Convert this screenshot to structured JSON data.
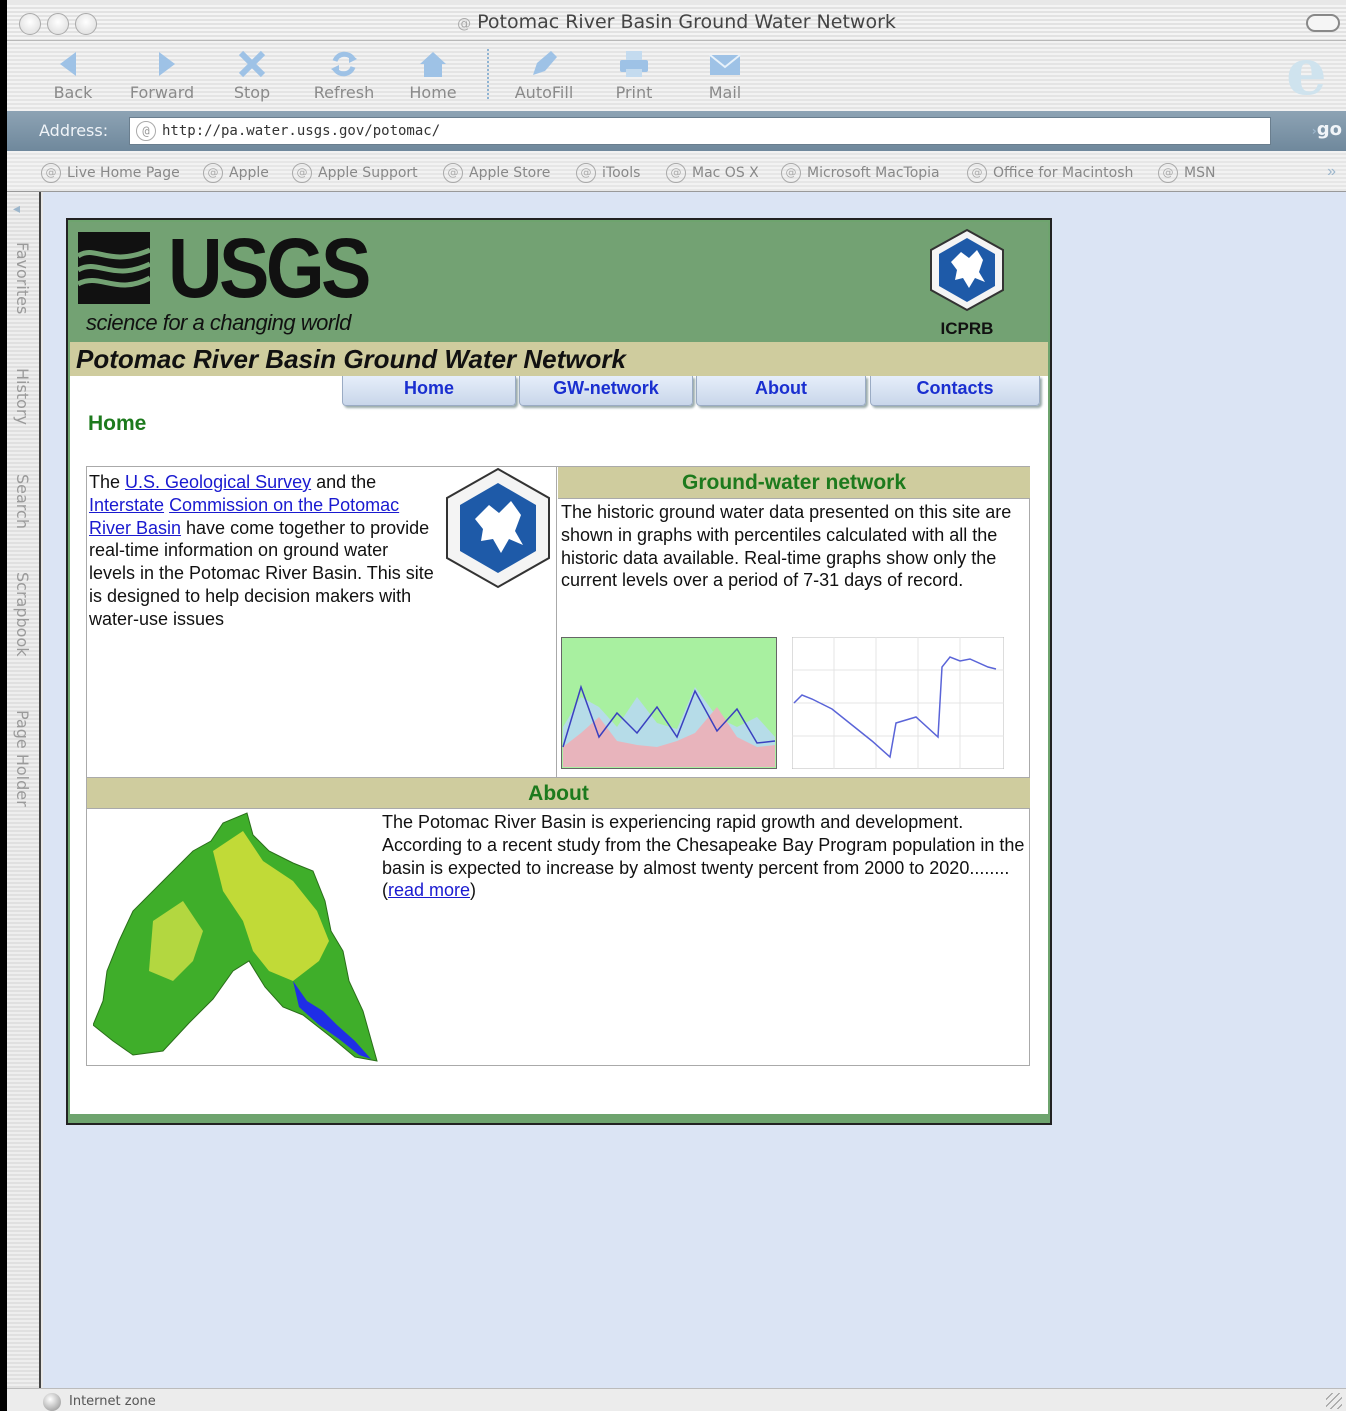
{
  "window": {
    "title": "Potomac River Basin Ground Water Network"
  },
  "toolbar": {
    "buttons": [
      {
        "label": "Back",
        "icon": "back-arrow-icon"
      },
      {
        "label": "Forward",
        "icon": "forward-arrow-icon"
      },
      {
        "label": "Stop",
        "icon": "stop-x-icon"
      },
      {
        "label": "Refresh",
        "icon": "refresh-icon"
      },
      {
        "label": "Home",
        "icon": "home-icon"
      },
      {
        "label": "AutoFill",
        "icon": "autofill-icon"
      },
      {
        "label": "Print",
        "icon": "printer-icon"
      },
      {
        "label": "Mail",
        "icon": "mail-envelope-icon"
      }
    ]
  },
  "address": {
    "label": "Address:",
    "url": "http://pa.water.usgs.gov/potomac/",
    "go_label": "go"
  },
  "favorites": [
    "Live Home Page",
    "Apple",
    "Apple Support",
    "Apple Store",
    "iTools",
    "Mac OS X",
    "Microsoft MacTopia",
    "Office for Macintosh",
    "MSN"
  ],
  "sidebar": {
    "tabs": [
      "Favorites",
      "History",
      "Search",
      "Scrapbook",
      "Page Holder"
    ]
  },
  "status": {
    "text": "Internet zone"
  },
  "page": {
    "logo_text": "USGS",
    "tagline": "science for a changing world",
    "partner_label": "ICPRB",
    "site_title": "Potomac River Basin Ground Water Network",
    "nav": [
      "Home",
      "GW-network",
      "About",
      "Contacts"
    ],
    "heading": "Home",
    "intro": {
      "t1": "The ",
      "link1": "U.S. Geological Survey",
      "t2": " and the ",
      "link2": "Interstate",
      "t3": " ",
      "link3": "Commission on the Potomac River Basin",
      "t4": " have come together to provide real-time information on ground water levels in the Potomac River Basin. This site is designed to help decision makers with water-use issues"
    },
    "gw": {
      "title": "Ground-water network",
      "text": "The historic ground water data presented on this site are shown in graphs with percentiles calculated with all the historic data available. Real-time graphs show only the current levels over a period of 7-31 days of record."
    },
    "about": {
      "title": "About",
      "text": "The Potomac River Basin is experiencing rapid growth and development. According to a recent study from the Chesapeake Bay Program population in the basin is expected to increase by almost twenty percent from 2000 to 2020........ ",
      "open_paren": "(",
      "link": "read more",
      "close_paren": ")"
    }
  }
}
